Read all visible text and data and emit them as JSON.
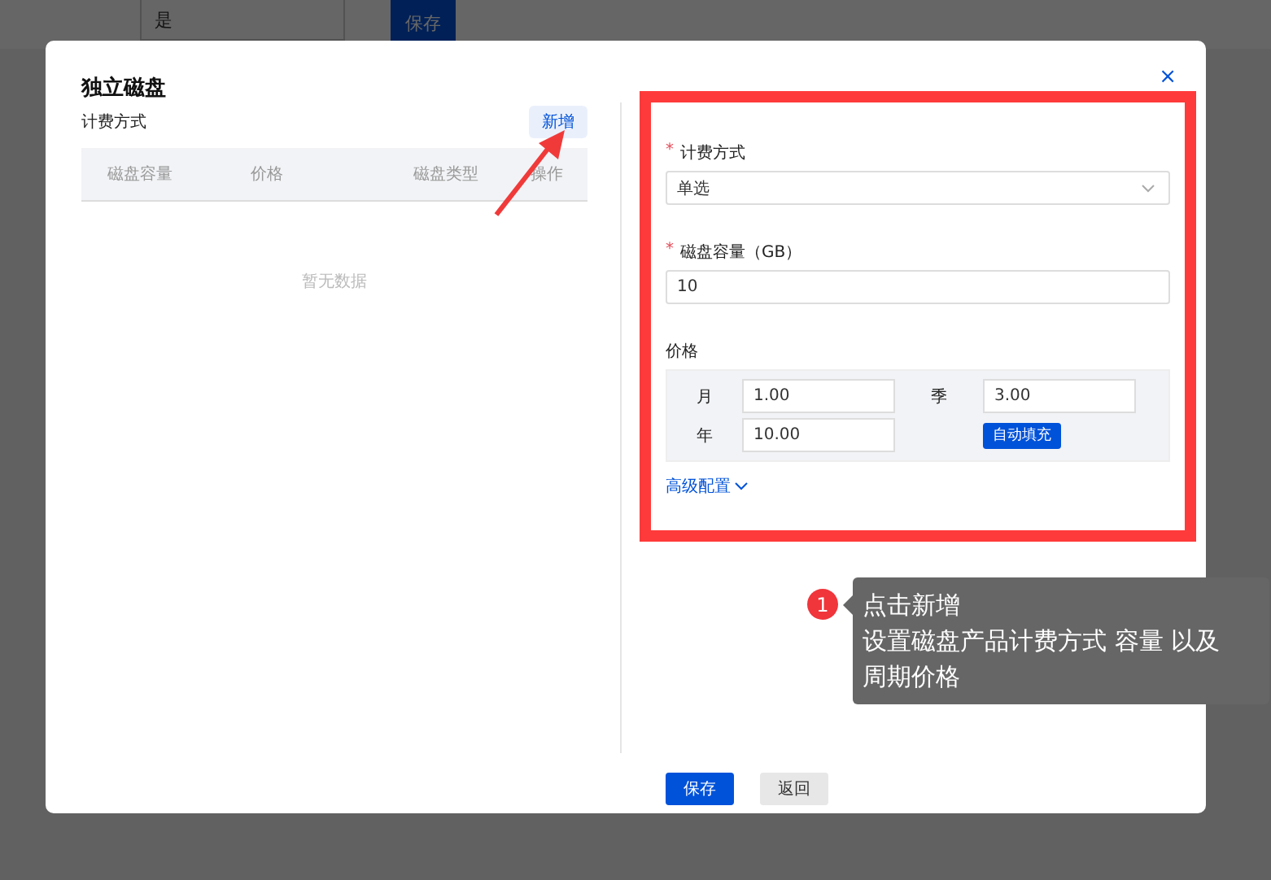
{
  "background": {
    "select": {
      "value": "是"
    },
    "button": "保存"
  },
  "dialog": {
    "title": "独立磁盘",
    "close": "×",
    "billing_list": {
      "label": "计费方式",
      "add_button": "新增",
      "columns": [
        "磁盘容量",
        "价格",
        "磁盘类型",
        "操作"
      ],
      "empty_text": "暂无数据"
    },
    "form": {
      "fields": [
        {
          "kind": "select",
          "label": "计费方式",
          "required_mark": "*",
          "value": "单选"
        },
        {
          "kind": "input",
          "label": "磁盘容量（GB）",
          "required_mark": "*",
          "value": "10"
        }
      ],
      "price": {
        "label": "价格",
        "periods": [
          {
            "label": "月",
            "value": "1.00"
          },
          {
            "label": "季",
            "value": "3.00"
          },
          {
            "label": "年",
            "value": "10.00"
          }
        ],
        "autofill_button": "自动填充"
      },
      "advanced": {
        "label": "高级配置",
        "expanded": false
      }
    },
    "buttons": [
      {
        "kind": "primary",
        "label": "保存"
      },
      {
        "kind": "default",
        "label": "返回"
      }
    ]
  },
  "annotation": {
    "number": "1",
    "lines": [
      "点击新增",
      "设置磁盘产品计费方式 容量 以及",
      "周期价格"
    ]
  }
}
